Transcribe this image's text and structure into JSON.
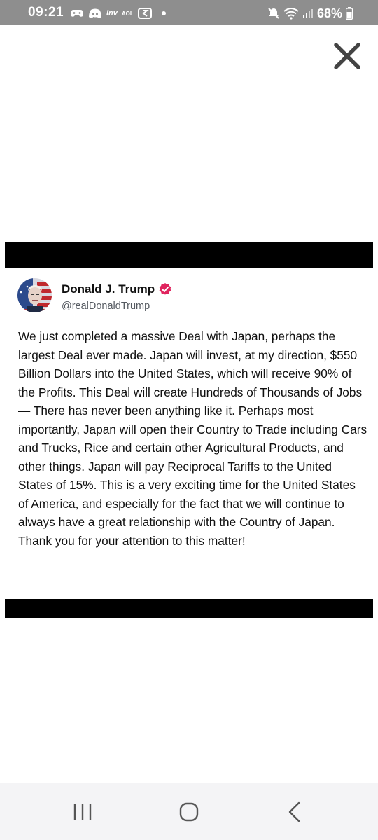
{
  "status_bar": {
    "time": "09:21",
    "inv_label": "inv",
    "aol_label": "AOL",
    "battery": "68%",
    "icons": [
      "game-controller-icon",
      "discord-icon",
      "inv-icon",
      "aol-icon",
      "snapchat-like-icon",
      "notification-dot",
      "mute-icon",
      "wifi-icon",
      "signal-icon",
      "battery-icon"
    ]
  },
  "close_icon": "close-icon",
  "post": {
    "author_name": "Donald J. Trump",
    "verified_icon": "verified-badge-icon",
    "author_handle": "@realDonaldTrump",
    "body": "We just completed a massive Deal with Japan, perhaps the largest Deal ever made. Japan will invest, at my direction, $550 Billion Dollars into the United States, which will receive 90% of the Profits. This Deal will create Hundreds of Thousands of Jobs — There has never been anything like it. Perhaps most importantly, Japan will open their Country to Trade including Cars and Trucks, Rice and certain other Agricultural Products, and other things. Japan will pay Reciprocal Tariffs to the United States of 15%. This is a very exciting time for the United States of America, and especially for the fact that we will continue to always have a great relationship with the Country of Japan. Thank you for your attention to this matter!"
  },
  "colors": {
    "status_bar_bg": "#8e8e8e",
    "verified_badge": "#e0245e",
    "handle_text": "#555a61",
    "nav_bar_bg": "#f4f4f6"
  },
  "nav_bar": {
    "icons": [
      "recent-apps-icon",
      "home-icon",
      "back-icon"
    ]
  }
}
